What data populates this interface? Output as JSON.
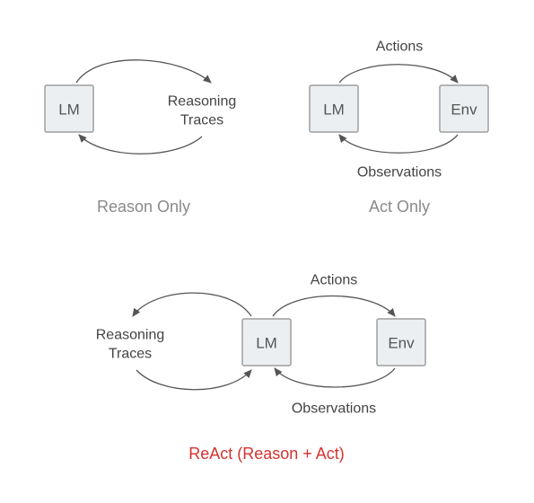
{
  "diagram": {
    "panels": {
      "reason_only": {
        "caption": "Reason Only",
        "lm": "LM",
        "reasoning_label_l1": "Reasoning",
        "reasoning_label_l2": "Traces"
      },
      "act_only": {
        "caption": "Act Only",
        "lm": "LM",
        "env": "Env",
        "actions_label": "Actions",
        "observations_label": "Observations"
      },
      "react": {
        "caption": "ReAct (Reason + Act)",
        "lm": "LM",
        "env": "Env",
        "reasoning_label_l1": "Reasoning",
        "reasoning_label_l2": "Traces",
        "actions_label": "Actions",
        "observations_label": "Observations"
      }
    }
  }
}
